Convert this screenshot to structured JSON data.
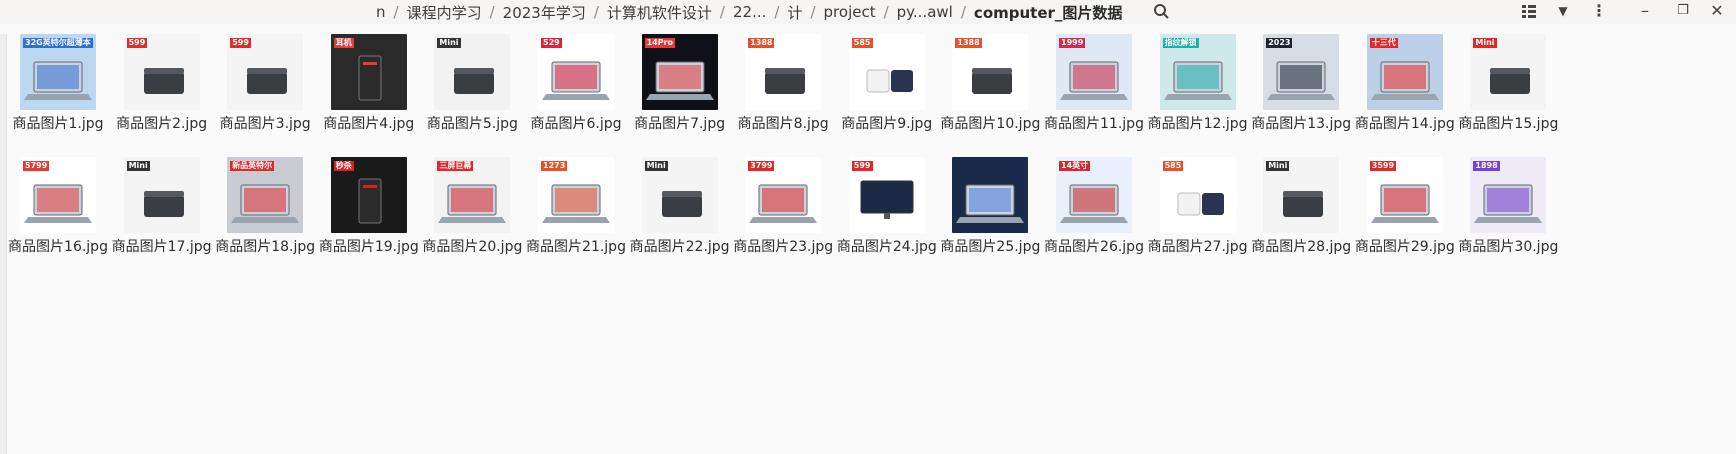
{
  "path": {
    "crumbs": [
      "n",
      "课程内学习",
      "2023年学习",
      "计算机软件设计",
      "22...",
      "计",
      "project",
      "py...awl",
      "computer_图片数据"
    ]
  },
  "toolbar": {
    "menu_icon": "kebab-vertical-icon",
    "search_icon": "search-icon",
    "view_icon": "list-grid-view-icon",
    "sort_icon": "chevron-down-icon",
    "more_icon": "kebab-vertical-icon"
  },
  "files": [
    {
      "name": "商品图片1.jpg",
      "thumb": {
        "bg": "#bcd7f0",
        "accent": "#2f6fd0",
        "obj": "laptop",
        "tag": "32G英特尔超薄本"
      }
    },
    {
      "name": "商品图片2.jpg",
      "thumb": {
        "bg": "#f4f4f4",
        "accent": "#d8302a",
        "obj": "minipc",
        "tag": "599"
      }
    },
    {
      "name": "商品图片3.jpg",
      "thumb": {
        "bg": "#f4f4f4",
        "accent": "#d8302a",
        "obj": "minipc",
        "tag": "599"
      }
    },
    {
      "name": "商品图片4.jpg",
      "thumb": {
        "bg": "#2a2a2a",
        "accent": "#e23b3b",
        "obj": "tower",
        "tag": "耳机"
      }
    },
    {
      "name": "商品图片5.jpg",
      "thumb": {
        "bg": "#f2f2f2",
        "accent": "#333333",
        "obj": "minipc",
        "tag": "Mini"
      }
    },
    {
      "name": "商品图片6.jpg",
      "thumb": {
        "bg": "#ffffff",
        "accent": "#e2203a",
        "obj": "laptop",
        "tag": "529"
      }
    },
    {
      "name": "商品图片7.jpg",
      "thumb": {
        "bg": "#101018",
        "accent": "#e53935",
        "obj": "laptop",
        "tag": "14Pro"
      }
    },
    {
      "name": "商品图片8.jpg",
      "thumb": {
        "bg": "#ffffff",
        "accent": "#e8502a",
        "obj": "minipc",
        "tag": "1388"
      }
    },
    {
      "name": "商品图片9.jpg",
      "thumb": {
        "bg": "#ffffff",
        "accent": "#e8502a",
        "obj": "cube",
        "tag": "585"
      }
    },
    {
      "name": "商品图片10.jpg",
      "thumb": {
        "bg": "#ffffff",
        "accent": "#e8502a",
        "obj": "minipc",
        "tag": "1388"
      }
    },
    {
      "name": "商品图片11.jpg",
      "thumb": {
        "bg": "#dfe8f6",
        "accent": "#d12a4a",
        "obj": "laptop",
        "tag": "1999"
      }
    },
    {
      "name": "商品图片12.jpg",
      "thumb": {
        "bg": "#cfe9ea",
        "accent": "#1bb0a8",
        "obj": "laptop",
        "tag": "指纹解锁"
      }
    },
    {
      "name": "商品图片13.jpg",
      "thumb": {
        "bg": "#d6dde6",
        "accent": "#1e2430",
        "obj": "laptop",
        "tag": "2023"
      }
    },
    {
      "name": "商品图片14.jpg",
      "thumb": {
        "bg": "#bcd0e8",
        "accent": "#e02828",
        "obj": "laptop",
        "tag": "十三代"
      }
    },
    {
      "name": "商品图片15.jpg",
      "thumb": {
        "bg": "#f4f4f4",
        "accent": "#e02828",
        "obj": "minipc",
        "tag": "Mini"
      }
    },
    {
      "name": "商品图片16.jpg",
      "thumb": {
        "bg": "#ffffff",
        "accent": "#e53935",
        "obj": "laptop",
        "tag": "5799"
      }
    },
    {
      "name": "商品图片17.jpg",
      "thumb": {
        "bg": "#f4f4f4",
        "accent": "#333333",
        "obj": "minipc",
        "tag": "Mini"
      }
    },
    {
      "name": "商品图片18.jpg",
      "thumb": {
        "bg": "#c8ccd2",
        "accent": "#e02828",
        "obj": "laptop",
        "tag": "新品英特尔"
      }
    },
    {
      "name": "商品图片19.jpg",
      "thumb": {
        "bg": "#1a1a1a",
        "accent": "#d8202a",
        "obj": "tower",
        "tag": "秒杀"
      }
    },
    {
      "name": "商品图片20.jpg",
      "thumb": {
        "bg": "#f3f3f3",
        "accent": "#e02828",
        "obj": "laptop",
        "tag": "三屏巨幕"
      }
    },
    {
      "name": "商品图片21.jpg",
      "thumb": {
        "bg": "#ffffff",
        "accent": "#e8502a",
        "obj": "laptop",
        "tag": "1273"
      }
    },
    {
      "name": "商品图片22.jpg",
      "thumb": {
        "bg": "#f4f4f4",
        "accent": "#333333",
        "obj": "minipc",
        "tag": "Mini"
      }
    },
    {
      "name": "商品图片23.jpg",
      "thumb": {
        "bg": "#ffffff",
        "accent": "#e02828",
        "obj": "laptop",
        "tag": "3799"
      }
    },
    {
      "name": "商品图片24.jpg",
      "thumb": {
        "bg": "#ffffff",
        "accent": "#e02828",
        "obj": "monitor",
        "tag": "599"
      }
    },
    {
      "name": "商品图片25.jpg",
      "thumb": {
        "bg": "#1a2a4a",
        "accent": "#4a7cd8",
        "obj": "laptop",
        "tag": ""
      }
    },
    {
      "name": "商品图片26.jpg",
      "thumb": {
        "bg": "#e8f1fb",
        "accent": "#d12a2a",
        "obj": "laptop",
        "tag": "14英寸"
      }
    },
    {
      "name": "商品图片27.jpg",
      "thumb": {
        "bg": "#ffffff",
        "accent": "#e8502a",
        "obj": "cube",
        "tag": "585"
      }
    },
    {
      "name": "商品图片28.jpg",
      "thumb": {
        "bg": "#f4f4f4",
        "accent": "#333333",
        "obj": "minipc",
        "tag": "Mini"
      }
    },
    {
      "name": "商品图片29.jpg",
      "thumb": {
        "bg": "#ffffff",
        "accent": "#e02828",
        "obj": "laptop",
        "tag": "3599"
      }
    },
    {
      "name": "商品图片30.jpg",
      "thumb": {
        "bg": "#eeeaf6",
        "accent": "#7b3fd6",
        "obj": "laptop",
        "tag": "1898"
      }
    }
  ],
  "colors": {
    "header_bg": "#f6f5f4",
    "view_bg": "#fafafa",
    "text": "#2e2e2e"
  }
}
